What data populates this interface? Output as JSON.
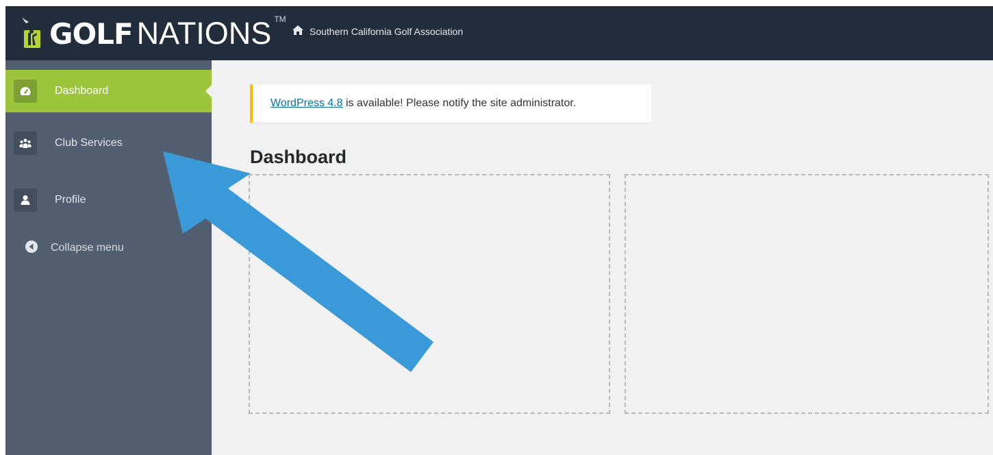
{
  "brand": {
    "logo_bold": "GOLF",
    "logo_light": "NATIONS",
    "logo_tm": "TM",
    "site_name": "Southern California Golf Association"
  },
  "icons": {
    "home": "home-icon",
    "dashboard": "dashboard-gauge-icon",
    "club_services": "group-people-icon",
    "profile": "user-icon",
    "collapse": "collapse-arrow-icon"
  },
  "sidebar": {
    "items": [
      {
        "label": "Dashboard",
        "active": true
      },
      {
        "label": "Club Services",
        "active": false
      },
      {
        "label": "Profile",
        "active": false
      }
    ],
    "collapse_label": "Collapse menu"
  },
  "notice": {
    "link_text": "WordPress 4.8",
    "message": " is available! Please notify the site administrator."
  },
  "main": {
    "title": "Dashboard"
  },
  "colors": {
    "topbar": "#222d3b",
    "sidebar": "#525f70",
    "active": "#9cc53c",
    "notice_border": "#ffba00",
    "annotation_arrow": "#3a9ad9"
  }
}
